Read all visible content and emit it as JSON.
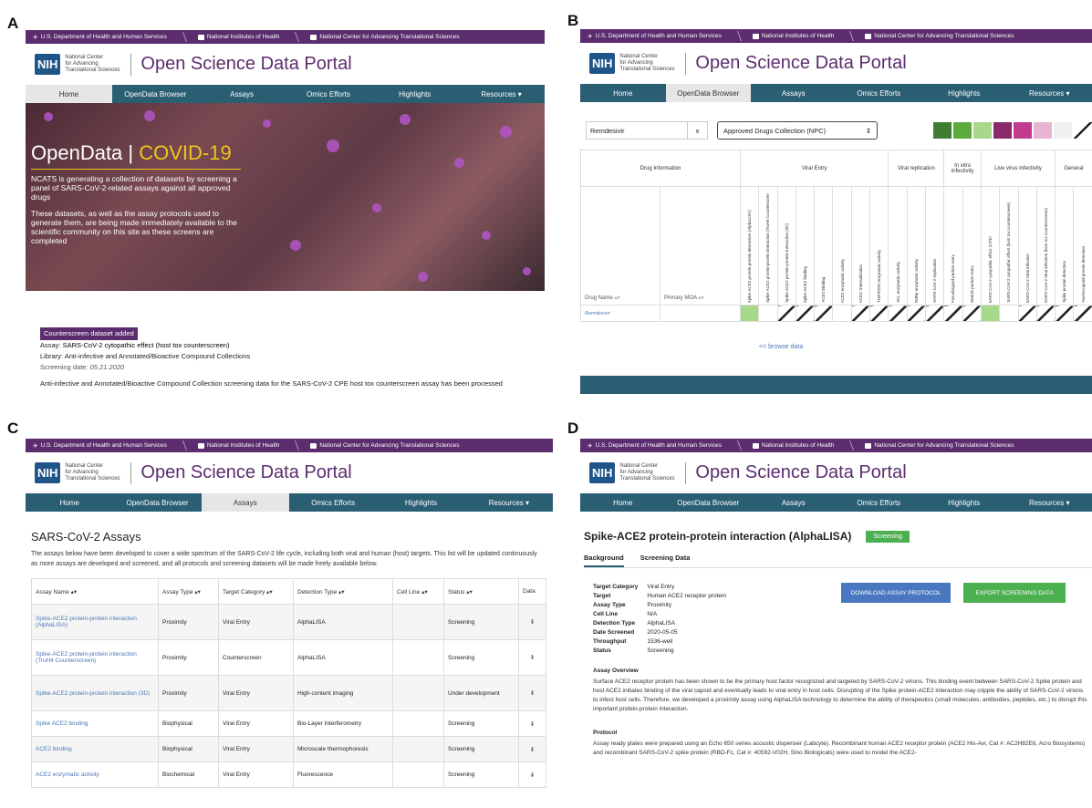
{
  "labels": {
    "a": "A",
    "b": "B",
    "c": "C",
    "d": "D"
  },
  "header": {
    "gov_links": [
      "U.S. Department of Health and Human Services",
      "National Institutes of Health",
      "National Center for Advancing Translational Sciences"
    ],
    "nih": "NIH",
    "ncats_lines": [
      "National Center",
      "for Advancing",
      "Translational Sciences"
    ],
    "portal_title": "Open Science Data Portal",
    "nav": [
      "Home",
      "OpenData Browser",
      "Assays",
      "Omics Efforts",
      "Highlights",
      "Resources ▾"
    ]
  },
  "panel_a": {
    "hero_title_left": "OpenData",
    "hero_title_sep": " | ",
    "hero_title_right": "COVID-19",
    "hero_p1": "NCATS is generating a collection of datasets by screening a panel of SARS-CoV-2-related assays against all approved drugs",
    "hero_p2": "These datasets, as well as the assay protocols used to generate them, are being made immediately available to the scientific community on this site as these screens are completed",
    "badge": "Counterscreen dataset added",
    "assay_label": "Assay: ",
    "assay_value": "SARS-CoV-2 cytopathic effect (host tox counterscreen)",
    "library_label": "Library: ",
    "library_value": "Anti-infective and Annotated/Bioactive Compound Collections",
    "date_label": "Screening date: ",
    "date_value": "05.21.2020",
    "summary": "Anti-infective and Annotated/Bioactive Compound Collection screening data for the SARS-CoV-2 CPE host tox counterscreen assay has been processed"
  },
  "panel_b": {
    "search_value": "Remdesivir",
    "clear": "x",
    "collection": "Approved Drugs Collection (NPC)",
    "colors": [
      "#3e7d32",
      "#5bab3c",
      "#a8d88c",
      "#8a2a6a",
      "#c23b8f",
      "#e8b4d2",
      "#f0f0f0"
    ],
    "groups": [
      "Drug Information",
      "Viral Entry",
      "Viral replication",
      "In vitro infectivity",
      "Live virus infectivity",
      "General"
    ],
    "col_drug": "Drug Name ▵▿",
    "col_moa": "Primary MOA ▵▿",
    "assay_cols": [
      "Spike-ACE2 protein-protein interaction (AlphaLISA)",
      "Spike-ACE2 protein-protein interaction (TruHit Counterscreen)",
      "Spike-ACE2 protein-protein interaction (3D)",
      "Spike-ACE2 binding",
      "ACE2 binding",
      "ACE2 enzymatic activity",
      "ACE2: Internalization",
      "TMPRSS2 enzymatic activity",
      "3CL enzymatic activity",
      "RdRp enzymatic activity",
      "SARS-CoV-2 replication",
      "Pseudotyped particle entry",
      "Vesicle particle entry",
      "SARS-CoV-2 cytopathic effect (CPE)",
      "SARS-CoV-2 cytopathic effect (host tox counterscreen)",
      "SARS-CoV-2 Viral infection",
      "SARS-CoV-2 Viral infection (host tox counterscreen)",
      "Spike protein detection",
      "Nucleocapsid protein detection"
    ],
    "row_drug": "Remdesivir",
    "browse": "<< browse data"
  },
  "panel_c": {
    "title": "SARS-CoV-2 Assays",
    "intro": "The assays below have been developed to cover a wide spectrum of the SARS-CoV-2 life cycle, including both viral and human (host) targets. This list will be updated continuously as more assays are developed and screened, and all protocols and screening datasets will be made freely available below.",
    "headers": [
      "Assay Name ▴▾",
      "Assay Type ▴▾",
      "Target Category ▴▾",
      "Detection Type ▴▾",
      "Cell Line ▴▾",
      "Status ▴▾",
      "Data"
    ],
    "rows": [
      [
        "Spike-ACE2 protein-protein interaction (AlphaLISA)",
        "Proximity",
        "Viral Entry",
        "AlphaLISA",
        "",
        "Screening",
        "⬇"
      ],
      [
        "Spike-ACE2 protein-protein interaction (TruHit Counterscreen)",
        "Proximity",
        "Counterscreen",
        "AlphaLISA",
        "",
        "Screening",
        "⬇"
      ],
      [
        "Spike-ACE2 protein-protein interaction (3D)",
        "Proximity",
        "Viral Entry",
        "High-content imaging",
        "",
        "Under development",
        "⬇"
      ],
      [
        "Spike ACE2 binding",
        "Biophysical",
        "Viral Entry",
        "Bio-Layer Interferometry",
        "",
        "Screening",
        "⬇"
      ],
      [
        "ACE2 binding",
        "Biophysical",
        "Viral Entry",
        "Microscale thermophoresis",
        "",
        "Screening",
        "⬇"
      ],
      [
        "ACE2 enzymatic activity",
        "Biochemical",
        "Viral Entry",
        "Fluorescence",
        "",
        "Screening",
        "⬇"
      ]
    ]
  },
  "panel_d": {
    "title": "Spike-ACE2 protein-protein interaction (AlphaLISA)",
    "status_badge": "Screening",
    "tabs": [
      "Background",
      "Screening Data"
    ],
    "details": [
      [
        "Target Category",
        "Viral Entry"
      ],
      [
        "Target",
        "Human ACE2 receptor protein"
      ],
      [
        "Assay Type",
        "Proximity"
      ],
      [
        "Cell Line",
        "N/A"
      ],
      [
        "Detection Type",
        "AlphaLISA"
      ],
      [
        "Date Screened",
        "2020-05-05"
      ],
      [
        "Throughput",
        "1536-well"
      ],
      [
        "Status",
        "Screening"
      ]
    ],
    "download_btn": "DOWNLOAD ASSAY PROTOCOL",
    "export_btn": "EXPORT SCREENING DATA",
    "overview_title": "Assay Overview",
    "overview": "Surface ACE2 receptor protein has been shown to be the primary host factor recognized and targeted by SARS-CoV-2 virions. This binding event between SARS-CoV-2 Spike protein and host ACE2 initiates binding of the viral capsid and eventually leads to viral entry in host cells. Disrupting of the Spike protein-ACE2 interaction may cripple the ability of SARS-CoV-2 virions to infect host cells. Therefore, we developed a proximity assay using AlphaLISA technology to determine the ability of therapeutics (small molecules, antibodies, peptides, etc.) to disrupt this important protein-protein interaction.",
    "protocol_title": "Protocol",
    "protocol": "Assay ready plates were prepared using an Echo 650 series acoustic dispenser (Labcyte). Recombinant human ACE2 receptor protein (ACE2 His-Avi, Cat #: AC2H82E6, Acro Biosystems) and recombinant SARS-CoV-2 spike protein (RBD-Fc, Cat #: 40592-V02H, Sino Biologicals) were used to model the ACE2-"
  }
}
